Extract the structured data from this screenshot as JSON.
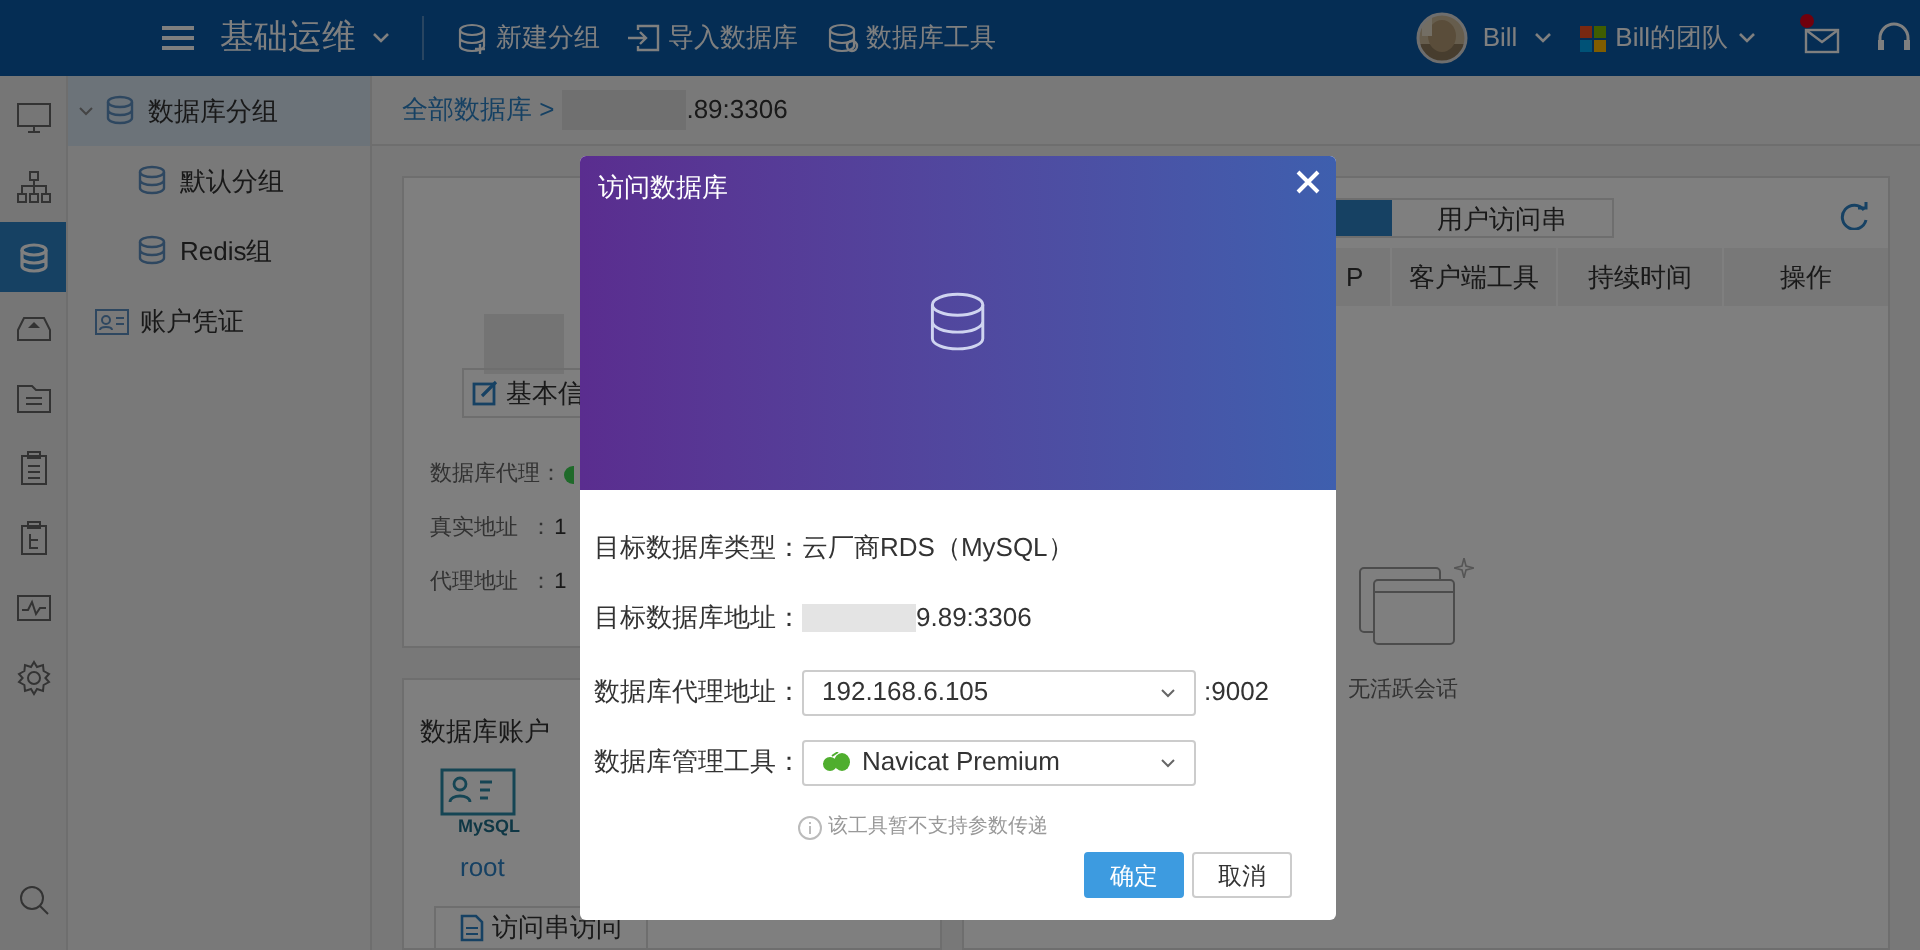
{
  "top_bar": {
    "module": "基础运维",
    "actions": [
      {
        "kind": "add",
        "label": "新建分组"
      },
      {
        "kind": "import",
        "label": "导入数据库"
      },
      {
        "kind": "tools",
        "label": "数据库工具"
      }
    ],
    "user": "Bill",
    "team": "Bill的团队",
    "has_unread_mail": true
  },
  "rail": [
    {
      "kind": "monitor",
      "selected": false
    },
    {
      "kind": "network",
      "selected": false
    },
    {
      "kind": "database",
      "selected": true
    },
    {
      "kind": "drive",
      "selected": false
    },
    {
      "kind": "list",
      "selected": false
    },
    {
      "kind": "clipboard",
      "selected": false
    },
    {
      "kind": "clipboard2",
      "selected": false
    },
    {
      "kind": "pulse",
      "selected": false
    },
    {
      "kind": "gear",
      "selected": false
    },
    {
      "kind": "search",
      "selected": false
    }
  ],
  "sidebar": {
    "items": [
      {
        "kind": "db",
        "label": "数据库分组",
        "selected": true,
        "expanded": true,
        "children": [
          {
            "kind": "db",
            "label": "默认分组",
            "selected": false
          },
          {
            "kind": "db",
            "label": "Redis组",
            "selected": false
          }
        ]
      },
      {
        "kind": "card",
        "label": "账户凭证",
        "selected": false
      }
    ]
  },
  "breadcrumb": {
    "root": "全部数据库 >",
    "current": ".89:3306"
  },
  "info_card": {
    "button": "基本信",
    "fields": [
      {
        "label": "数据库代理：",
        "color": "#1f6a2a"
      },
      {
        "label": "真实地址  ：",
        "value": "1"
      },
      {
        "label": "代理地址  ：",
        "value": "1"
      }
    ]
  },
  "accounts_card": {
    "title": "数据库账户",
    "logo_text": "MySQL",
    "account": "root",
    "button": "访问串访问"
  },
  "sessions_card": {
    "tabs": [
      {
        "selected": true
      },
      {
        "label": "用户访问串",
        "selected": false
      }
    ],
    "columns": [
      "P",
      "客户端工具",
      "持续时间",
      "操作"
    ],
    "empty_text": "无活跃会话"
  },
  "dialog": {
    "title": "访问数据库",
    "fields": [
      {
        "kind": "text",
        "label": "目标数据库类型：",
        "value": "云厂商RDS（MySQL）"
      },
      {
        "kind": "masked",
        "label": "目标数据库地址：",
        "value": "9.89:3306"
      },
      {
        "kind": "select",
        "label": "数据库代理地址：",
        "value": "192.168.6.105",
        "suffix": ":9002"
      },
      {
        "kind": "tool_select",
        "label": "数据库管理工具：",
        "value": "Navicat Premium"
      }
    ],
    "hint": "该工具暂不支持参数传递",
    "buttons": [
      {
        "label": "确定",
        "primary": true
      },
      {
        "label": "取消",
        "primary": false
      }
    ]
  }
}
